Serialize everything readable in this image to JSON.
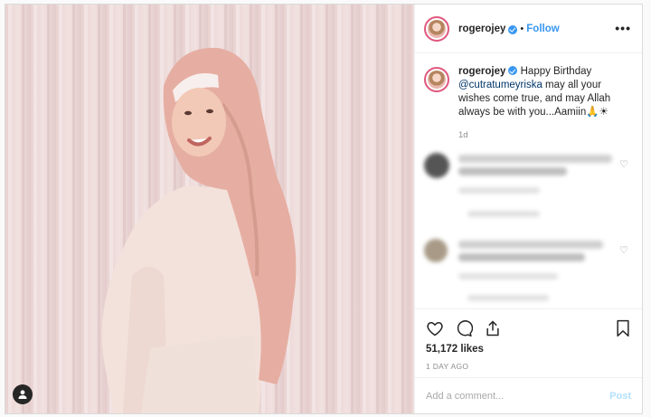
{
  "header": {
    "username": "rogerojey",
    "separator": "•",
    "follow_label": "Follow",
    "more_icon": "more-horizontal-icon",
    "more_label": "•••"
  },
  "caption": {
    "username": "rogerojey",
    "text_start": "Happy Birthday",
    "mention": "@cutratumeyriska",
    "text_end": "may all your wishes come true, and may Allah always be with you...Aamiin🙏☀",
    "time": "1d"
  },
  "comments_note": "blurred",
  "actions": {
    "like_icon": "heart-icon",
    "comment_icon": "comment-icon",
    "share_icon": "share-icon",
    "save_icon": "bookmark-icon",
    "likes": "51,172 likes",
    "posted": "1 DAY AGO"
  },
  "add_comment": {
    "placeholder": "Add a comment...",
    "post_label": "Post"
  },
  "colors": {
    "accent": "#3897f0",
    "mention": "#003569",
    "post_disabled": "#b2dffc",
    "photo_bg": "#e7cfcd"
  }
}
